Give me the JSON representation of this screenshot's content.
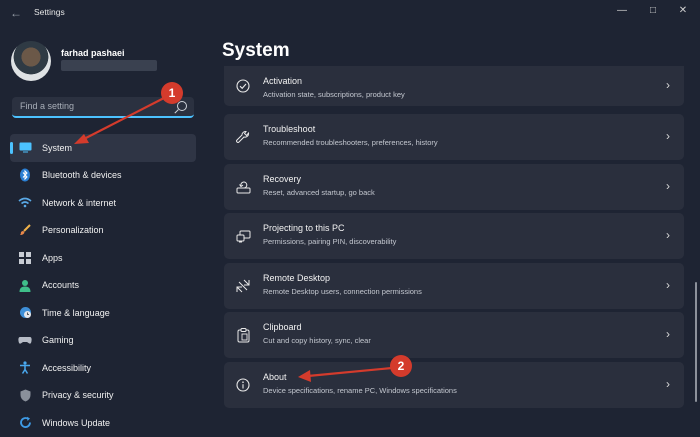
{
  "window": {
    "title": "Settings",
    "controls": [
      "minimize-icon",
      "maximize-icon",
      "close-icon"
    ]
  },
  "user": {
    "name": "farhad pashaei"
  },
  "search": {
    "placeholder": "Find a setting"
  },
  "sidebar": {
    "items": [
      {
        "label": "System",
        "icon": "monitor-icon",
        "active": true
      },
      {
        "label": "Bluetooth & devices",
        "icon": "bluetooth-icon"
      },
      {
        "label": "Network & internet",
        "icon": "wifi-icon"
      },
      {
        "label": "Personalization",
        "icon": "brush-icon"
      },
      {
        "label": "Apps",
        "icon": "apps-icon"
      },
      {
        "label": "Accounts",
        "icon": "person-icon"
      },
      {
        "label": "Time & language",
        "icon": "globe-clock-icon"
      },
      {
        "label": "Gaming",
        "icon": "controller-icon"
      },
      {
        "label": "Accessibility",
        "icon": "accessibility-icon"
      },
      {
        "label": "Privacy & security",
        "icon": "shield-icon"
      },
      {
        "label": "Windows Update",
        "icon": "update-icon"
      }
    ]
  },
  "main": {
    "title": "System",
    "cards": [
      {
        "title": "Activation",
        "subtitle": "Activation state, subscriptions, product key",
        "icon": "check-circle-icon"
      },
      {
        "title": "Troubleshoot",
        "subtitle": "Recommended troubleshooters, preferences, history",
        "icon": "wrench-icon"
      },
      {
        "title": "Recovery",
        "subtitle": "Reset, advanced startup, go back",
        "icon": "recovery-icon"
      },
      {
        "title": "Projecting to this PC",
        "subtitle": "Permissions, pairing PIN, discoverability",
        "icon": "projector-icon"
      },
      {
        "title": "Remote Desktop",
        "subtitle": "Remote Desktop users, connection permissions",
        "icon": "remote-desktop-icon"
      },
      {
        "title": "Clipboard",
        "subtitle": "Cut and copy history, sync, clear",
        "icon": "clipboard-icon"
      },
      {
        "title": "About",
        "subtitle": "Device specifications, rename PC, Windows specifications",
        "icon": "info-icon"
      }
    ]
  },
  "annotations": {
    "badge1": "1",
    "badge2": "2",
    "color": "#d43b2c"
  },
  "colors": {
    "background": "#1e2433",
    "card": "#2a2f3d",
    "accent": "#4cc2ff"
  }
}
